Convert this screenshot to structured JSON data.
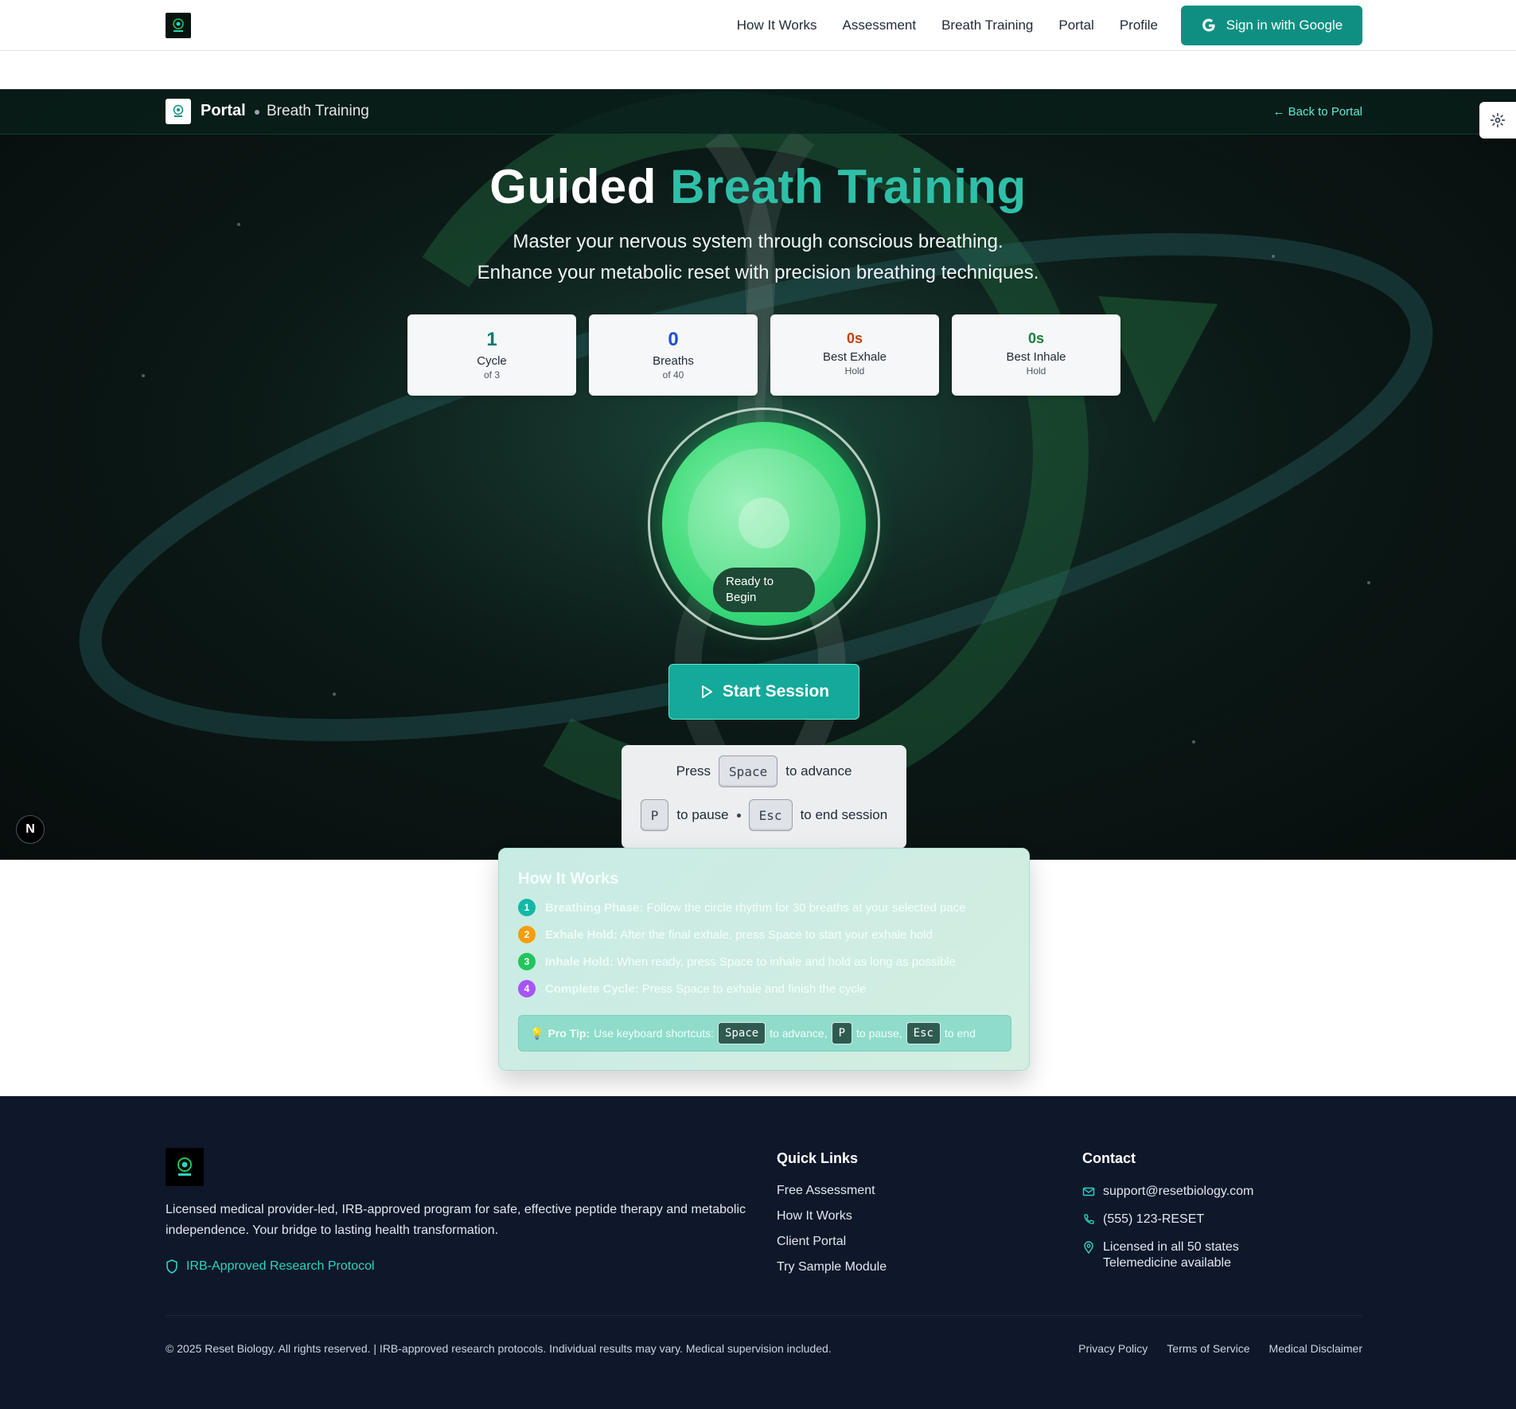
{
  "nav": {
    "links": [
      "How It Works",
      "Assessment",
      "Breath Training",
      "Portal",
      "Profile"
    ],
    "sign_in": "Sign in with Google"
  },
  "subbar": {
    "title": "Portal",
    "subtitle": "Breath Training",
    "back": "← Back to Portal"
  },
  "hero": {
    "title_main": "Guided",
    "title_accent": "Breath Training",
    "subtitle_1": "Master your nervous system through conscious breathing.",
    "subtitle_2": "Enhance your metabolic reset with precision breathing techniques.",
    "accent_color": "#2fbfa8"
  },
  "stats": [
    {
      "value": "1",
      "label": "Cycle",
      "sub": "of 3",
      "color": "#0f766e"
    },
    {
      "value": "0",
      "label": "Breaths",
      "sub": "of 40",
      "color": "#1d4ed8"
    },
    {
      "value": "0s",
      "label": "Best Exhale",
      "sub": "Hold",
      "color": "#c2410c"
    },
    {
      "value": "0s",
      "label": "Best Inhale",
      "sub": "Hold",
      "color": "#15803d"
    }
  ],
  "breath": {
    "status_line1": "Ready to",
    "status_line2": "Begin"
  },
  "start_button": "Start Session",
  "shortcuts": {
    "press": "Press",
    "space": "Space",
    "advance": "to advance",
    "p": "P",
    "pause": "to pause",
    "esc": "Esc",
    "end": "to end session"
  },
  "how": {
    "title": "How It Works",
    "steps": [
      {
        "n": "1",
        "color": "#14b8a6",
        "bold": "Breathing Phase:",
        "text": "Follow the circle rhythm for 30 breaths at your selected pace"
      },
      {
        "n": "2",
        "color": "#f59e0b",
        "bold": "Exhale Hold:",
        "text": "After the final exhale, press Space to start your exhale hold"
      },
      {
        "n": "3",
        "color": "#22c55e",
        "bold": "Inhale Hold:",
        "text": "When ready, press Space to inhale and hold as long as possible"
      },
      {
        "n": "4",
        "color": "#a855f7",
        "bold": "Complete Cycle:",
        "text": "Press Space to exhale and finish the cycle"
      }
    ],
    "tip_icon": "💡",
    "tip_bold": "Pro Tip:",
    "tip_text": "Use keyboard shortcuts:",
    "tip_space": "Space",
    "tip_advance": "to advance,",
    "tip_p": "P",
    "tip_pause": "to pause,",
    "tip_esc": "Esc",
    "tip_end": "to end"
  },
  "badge": "N",
  "footer": {
    "description": "Licensed medical provider-led, IRB-approved program for safe, effective peptide therapy and metabolic independence. Your bridge to lasting health transformation.",
    "irb": "IRB-Approved Research Protocol",
    "quick_title": "Quick Links",
    "quick_links": [
      "Free Assessment",
      "How It Works",
      "Client Portal",
      "Try Sample Module"
    ],
    "contact_title": "Contact",
    "email": "support@resetbiology.com",
    "phone": "(555) 123-RESET",
    "licensed_1": "Licensed in all 50 states",
    "licensed_2": "Telemedicine available",
    "copyright": "© 2025 Reset Biology. All rights reserved. | IRB-approved research protocols. Individual results may vary. Medical supervision included.",
    "legal": [
      "Privacy Policy",
      "Terms of Service",
      "Medical Disclaimer"
    ]
  }
}
